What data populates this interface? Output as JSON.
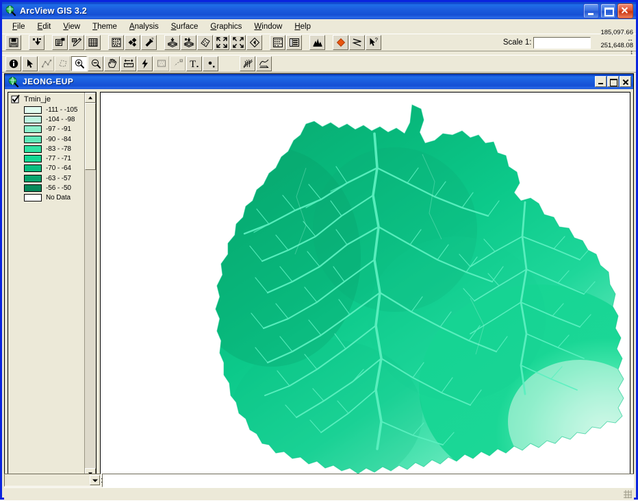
{
  "app": {
    "title": "ArcView GIS 3.2",
    "icon": "arcview-globe-icon"
  },
  "window_buttons": {
    "minimize": "Minimize",
    "maximize": "Maximize",
    "close": "Close"
  },
  "menubar": {
    "items": [
      {
        "label": "File",
        "accel": "F"
      },
      {
        "label": "Edit",
        "accel": "E"
      },
      {
        "label": "View",
        "accel": "V"
      },
      {
        "label": "Theme",
        "accel": "T"
      },
      {
        "label": "Analysis",
        "accel": "A"
      },
      {
        "label": "Surface",
        "accel": "S"
      },
      {
        "label": "Graphics",
        "accel": "G"
      },
      {
        "label": "Window",
        "accel": "W"
      },
      {
        "label": "Help",
        "accel": "H"
      }
    ]
  },
  "toolbar_main": {
    "buttons": [
      {
        "name": "save-project-icon",
        "title": "Save Project",
        "enabled": true
      },
      {
        "name": "add-theme-icon",
        "title": "Add Theme",
        "enabled": true
      },
      {
        "name": "theme-properties-icon",
        "title": "Theme Properties",
        "enabled": true
      },
      {
        "name": "edit-legend-icon",
        "title": "Edit Legend",
        "enabled": true
      },
      {
        "name": "open-table-icon",
        "title": "Open Theme Table",
        "enabled": true
      },
      {
        "name": "find-icon",
        "title": "Find",
        "enabled": true
      },
      {
        "name": "locate-address-icon",
        "title": "Locate Address",
        "enabled": true
      },
      {
        "name": "query-builder-icon",
        "title": "Query Builder",
        "enabled": true
      },
      {
        "name": "zoom-to-themes-icon",
        "title": "Zoom to Themes",
        "enabled": true
      },
      {
        "name": "zoom-to-selected-icon",
        "title": "Zoom to Selected",
        "enabled": true
      },
      {
        "name": "clear-selected-icon",
        "title": "Clear Selected Features",
        "enabled": true
      },
      {
        "name": "zoom-in-fixed-icon",
        "title": "Zoom In",
        "enabled": true
      },
      {
        "name": "zoom-out-fixed-icon",
        "title": "Zoom Out",
        "enabled": true
      },
      {
        "name": "zoom-previous-icon",
        "title": "Zoom to Previous Extent",
        "enabled": true
      },
      {
        "name": "select-feature-icon",
        "title": "Select Features",
        "enabled": true
      },
      {
        "name": "chart-window-icon",
        "title": "Create Chart",
        "enabled": true
      },
      {
        "name": "histogram-icon",
        "title": "Histogram",
        "enabled": true
      },
      {
        "name": "area-fill-icon",
        "title": "Fill Color",
        "enabled": true
      },
      {
        "name": "polyline-icon",
        "title": "Draw Line",
        "enabled": true
      },
      {
        "name": "help-pointer-icon",
        "title": "Help",
        "enabled": true
      }
    ]
  },
  "toolbar_tools": {
    "buttons": [
      {
        "name": "identify-icon",
        "title": "Identify",
        "state": "raised"
      },
      {
        "name": "pointer-icon",
        "title": "Pointer",
        "state": "raised"
      },
      {
        "name": "vertex-edit-icon",
        "title": "Vertex Edit",
        "state": "disabled"
      },
      {
        "name": "select-shape-icon",
        "title": "Select Feature",
        "state": "disabled"
      },
      {
        "name": "zoom-in-icon",
        "title": "Zoom In",
        "state": "pressed"
      },
      {
        "name": "zoom-out-icon",
        "title": "Zoom Out",
        "state": "raised"
      },
      {
        "name": "pan-hand-icon",
        "title": "Pan",
        "state": "raised"
      },
      {
        "name": "measure-icon",
        "title": "Measure",
        "state": "raised"
      },
      {
        "name": "hot-link-icon",
        "title": "Hot Link",
        "state": "raised"
      },
      {
        "name": "label-area-icon",
        "title": "Label",
        "state": "disabled"
      },
      {
        "name": "callout-icon",
        "title": "Callout",
        "state": "disabled"
      },
      {
        "name": "text-tool-icon",
        "title": "Text",
        "state": "raised"
      },
      {
        "name": "draw-point-icon",
        "title": "Draw Point",
        "state": "raised"
      },
      {
        "name": "contour-tool-icon",
        "title": "Contour Tool",
        "state": "raised"
      },
      {
        "name": "profile-tool-icon",
        "title": "Profile Tool",
        "state": "raised"
      }
    ]
  },
  "scale": {
    "label": "Scale  1:",
    "value": "",
    "placeholder": ""
  },
  "coordinates": {
    "x": "185,097.66",
    "y": "251,648.08",
    "x_arrow": "↔",
    "y_arrow": "↕"
  },
  "view_window": {
    "title": "JEONG-EUP",
    "icon": "view-globe-icon",
    "buttons": {
      "minimize": "Minimize",
      "maximize": "Maximize",
      "close": "Close"
    }
  },
  "legend": {
    "theme_name": "Tmin_je",
    "checked": true,
    "classes": [
      {
        "label": "-111 - -105",
        "color": "#e2fbf0"
      },
      {
        "label": "-104 - -98",
        "color": "#bdf6e0"
      },
      {
        "label": "-97 - -91",
        "color": "#8ef0cc"
      },
      {
        "label": "-90 - -84",
        "color": "#5fe9b8"
      },
      {
        "label": "-83 - -78",
        "color": "#2ee2a2"
      },
      {
        "label": "-77 - -71",
        "color": "#12d793"
      },
      {
        "label": "-70 - -64",
        "color": "#09be80"
      },
      {
        "label": "-63 - -57",
        "color": "#08a46d"
      },
      {
        "label": "-56 - -50",
        "color": "#07895b"
      },
      {
        "label": "No Data",
        "color": "#ffffff"
      }
    ]
  },
  "map": {
    "background": "#ffffff",
    "description": "Raster minimum-temperature surface for Jeong-eup region"
  },
  "status_bar": {
    "text": "",
    "grip": "resize-grip"
  },
  "bottom_strip": {
    "combo_value": "",
    "combo_icon": "chevron-down-icon"
  },
  "colors": {
    "titlebar_blue": "#1550d4",
    "window_frame": "#0a24de",
    "chrome": "#ece9d8",
    "accent_orange": "#e8560f"
  }
}
